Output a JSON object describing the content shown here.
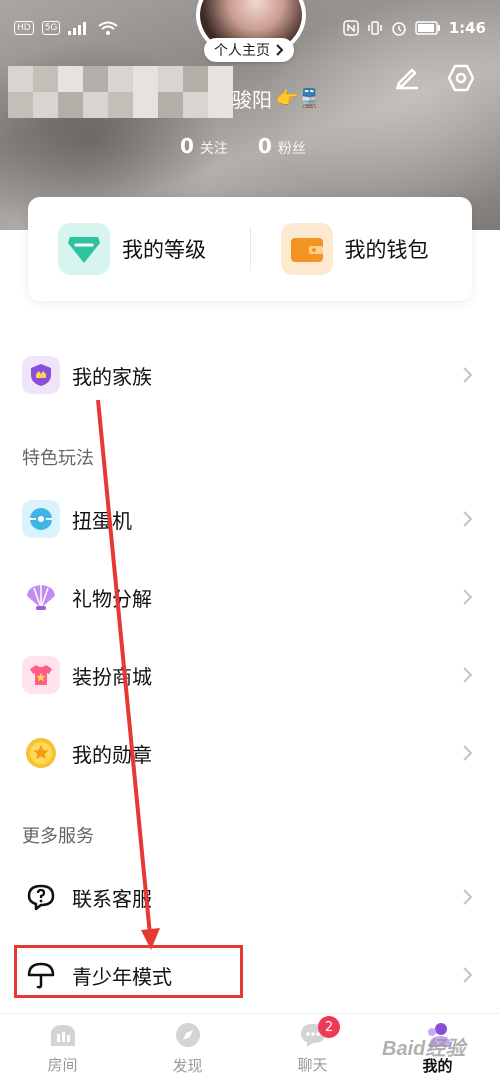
{
  "status_bar": {
    "left_chips": [
      "HD",
      "5G"
    ],
    "time": "1:46"
  },
  "profile": {
    "homepage_label": "个人主页",
    "name_visible": "骏阳",
    "name_emojis": "👉🚆",
    "following_count": "0",
    "following_label": "关注",
    "fans_count": "0",
    "fans_label": "粉丝"
  },
  "card": {
    "level_label": "我的等级",
    "wallet_label": "我的钱包"
  },
  "list": {
    "family": "我的家族",
    "section_features": "特色玩法",
    "gacha": "扭蛋机",
    "gift_decompose": "礼物分解",
    "dress_shop": "装扮商城",
    "badges": "我的勋章",
    "section_more": "更多服务",
    "support": "联系客服",
    "teen_mode": "青少年模式"
  },
  "bottom_nav": {
    "rooms": "房间",
    "discover": "发现",
    "chat": "聊天",
    "chat_badge": "2",
    "mine": "我的"
  },
  "colors": {
    "highlight": "#e53935",
    "badge": "#f03a55"
  },
  "watermark": "Baid经验"
}
